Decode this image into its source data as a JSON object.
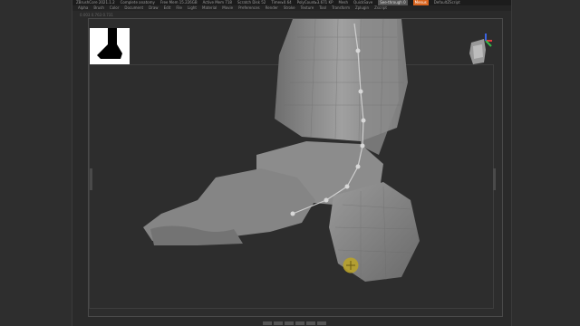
{
  "title_bar": {
    "app_title": "ZBrushCore 2021.1.2",
    "project": "Complete anatomy",
    "free_mem": "Free Mem 15.226GB",
    "active_mem": "Active Mem 718",
    "scratch_disk": "Scratch Disk 52",
    "timer": "Timer▸0.64",
    "poly_count": "PolyCount▸3.671 KP",
    "mesh_count": "Mesh",
    "quicksave_label": "QuickSave",
    "see_through": "See-through 0",
    "menus_label": "Menus",
    "default_zscript": "DefaultZScript"
  },
  "menu_bar": {
    "items": [
      "Alpha",
      "Brush",
      "Color",
      "Document",
      "Draw",
      "Edit",
      "File",
      "Light",
      "Material",
      "Movie",
      "Preferences",
      "Render",
      "Stroke",
      "Texture",
      "Tool",
      "Transform",
      "Zplugin",
      "Zscript"
    ]
  },
  "info_line": "0.003 0.763 0.731",
  "viewport": {
    "subject": "foot-anatomy-sculpt"
  },
  "colors": {
    "background": "#2b2b2b",
    "accent": "#d9641e",
    "gizmo": "#b8a22a",
    "mesh": "#8a8a8a"
  }
}
